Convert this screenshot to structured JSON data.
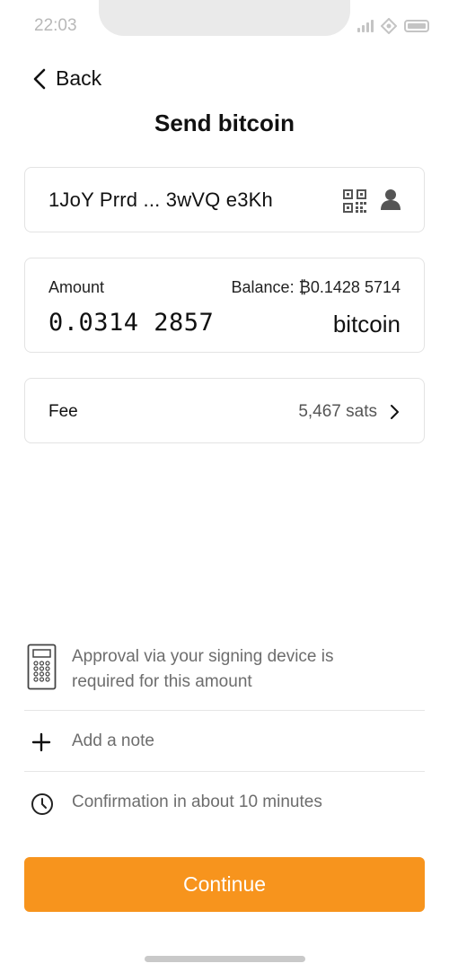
{
  "status_bar": {
    "time": "22:03"
  },
  "nav": {
    "back_label": "Back"
  },
  "page": {
    "title": "Send bitcoin"
  },
  "address": {
    "value": "1JoY Prrd ... 3wVQ e3Kh"
  },
  "amount": {
    "label": "Amount",
    "balance": "Balance: ₿0.1428 5714",
    "value": "0.0314 2857",
    "unit": "bitcoin"
  },
  "fee": {
    "label": "Fee",
    "value": "5,467 sats"
  },
  "info": {
    "approval_text": "Approval via your signing device is required for this amount",
    "note_text": "Add a note",
    "confirmation_text": "Confirmation in about 10 minutes"
  },
  "actions": {
    "continue_label": "Continue"
  },
  "colors": {
    "accent": "#f7941d",
    "muted_text": "#6d6d6d",
    "border": "#e3e3e3"
  },
  "icons": {
    "back": "chevron-left-icon",
    "qr": "qr-code-icon",
    "contact": "contact-icon",
    "fee_chevron": "chevron-right-icon",
    "device": "signing-device-icon",
    "note": "plus-icon",
    "clock": "clock-icon"
  }
}
